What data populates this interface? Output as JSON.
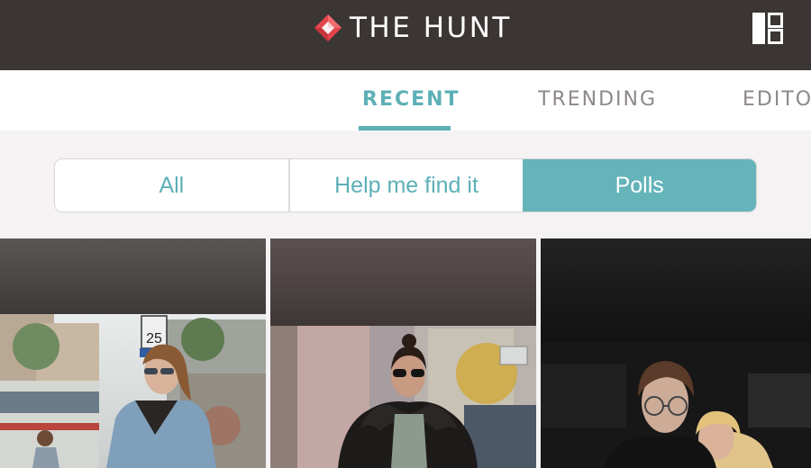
{
  "header": {
    "brand_name": "THE HUNT",
    "brand_icon": "diamond-logo-icon",
    "layout_icon": "layout-toggle-icon"
  },
  "tabs": [
    {
      "label": "RECENT",
      "active": true
    },
    {
      "label": "TRENDING",
      "active": false
    },
    {
      "label": "EDITO",
      "active": false
    }
  ],
  "filters": [
    {
      "label": "All",
      "selected": false
    },
    {
      "label": "Help me find it",
      "selected": false
    },
    {
      "label": "Polls",
      "selected": true
    }
  ],
  "feed": {
    "cards": [
      {
        "description": "street style photo",
        "sign_text": "25"
      },
      {
        "description": "street style photo"
      },
      {
        "description": "street style photo"
      }
    ]
  },
  "colors": {
    "header_bg": "#3b3634",
    "accent": "#5db0b7",
    "tab_inactive": "#8e8888",
    "page_bg": "#f4f2f2",
    "logo_red": "#e4454b"
  }
}
